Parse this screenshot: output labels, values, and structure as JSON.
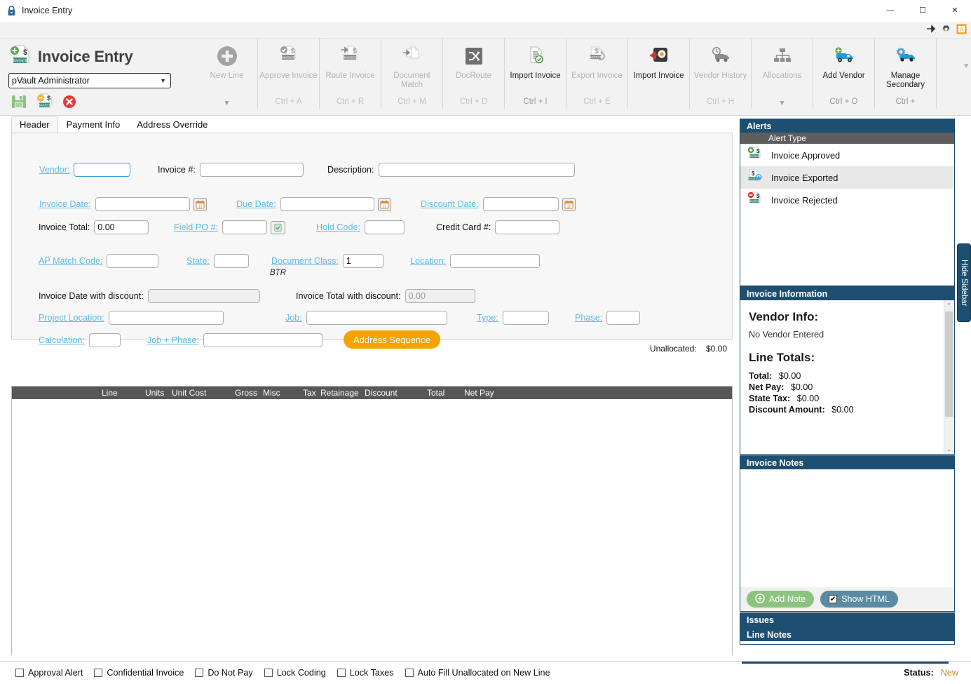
{
  "window": {
    "title": "Invoice Entry",
    "icon": "lock-icon",
    "minimize": "—",
    "maximize": "☐",
    "close": "✕"
  },
  "quickstrip": {
    "pin": "pin-icon",
    "settings": "gear-icon",
    "app": "app-icon"
  },
  "ribbon": {
    "app_title": "Invoice Entry",
    "app_icon": "invoice-add-icon",
    "user": "pVault Administrator",
    "user_caret": "▼",
    "quick_actions": [
      {
        "name": "save-icon",
        "label": "Save"
      },
      {
        "name": "save-invoice-icon",
        "label": "Save Invoice"
      },
      {
        "name": "cancel-icon",
        "label": "Cancel"
      }
    ],
    "groups": [
      {
        "label": "New Line",
        "shortcut": "",
        "icon": "plus-circle-icon",
        "disabled": true,
        "arrow": "▼"
      },
      {
        "label": "Approve Invoice",
        "shortcut": "Ctrl + A",
        "icon": "approve-invoice-icon",
        "disabled": true,
        "arrow": ""
      },
      {
        "label": "Route Invoice",
        "shortcut": "Ctrl + R",
        "icon": "route-invoice-icon",
        "disabled": true,
        "arrow": ""
      },
      {
        "label": "Document Match",
        "shortcut": "Ctrl + M",
        "icon": "document-match-icon",
        "disabled": true,
        "arrow": ""
      },
      {
        "label": "DocRoute",
        "shortcut": "Ctrl + D",
        "icon": "docroute-icon",
        "disabled": true,
        "arrow": ""
      },
      {
        "label": "Import Invoice",
        "shortcut": "Ctrl + I",
        "icon": "import-invoice-icon",
        "disabled": false,
        "arrow": ""
      },
      {
        "label": "Export Invoice",
        "shortcut": "Ctrl + E",
        "icon": "export-invoice-icon",
        "disabled": true,
        "arrow": ""
      },
      {
        "label": "Import Invoice",
        "shortcut": "",
        "icon": "import-invoice-alt-icon",
        "disabled": false,
        "arrow": ""
      },
      {
        "label": "Vendor History",
        "shortcut": "Ctrl + H",
        "icon": "vendor-history-icon",
        "disabled": true,
        "arrow": ""
      },
      {
        "label": "Allocations",
        "shortcut": "",
        "icon": "allocations-icon",
        "disabled": true,
        "arrow": "▼"
      },
      {
        "label": "Add Vendor",
        "shortcut": "Ctrl + O",
        "icon": "add-vendor-icon",
        "disabled": false,
        "arrow": ""
      },
      {
        "label": "Manage Secondary",
        "shortcut": "Ctrl +",
        "icon": "manage-secondary-icon",
        "disabled": false,
        "arrow": ""
      }
    ],
    "scroll_arrow": "▼"
  },
  "tabs": [
    {
      "label": "Header",
      "active": true
    },
    {
      "label": "Payment Info",
      "active": false
    },
    {
      "label": "Address Override",
      "active": false
    }
  ],
  "form": {
    "vendor": {
      "label": "Vendor:",
      "value": "",
      "link": true
    },
    "invoice_number": {
      "label": "Invoice #:",
      "value": "",
      "link": false
    },
    "description": {
      "label": "Description:",
      "value": "",
      "link": false
    },
    "invoice_date": {
      "label": "Invoice Date:",
      "value": "",
      "link": true,
      "calendar": "calendar-icon"
    },
    "due_date": {
      "label": "Due Date:",
      "value": "",
      "link": false,
      "calendar": "calendar-icon"
    },
    "discount_date": {
      "label": "Discount Date:",
      "value": "",
      "link": true,
      "calendar": "calendar-icon"
    },
    "invoice_total": {
      "label": "Invoice Total:",
      "value": "0.00",
      "link": false
    },
    "field_po": {
      "label": "Field PO #:",
      "value": "",
      "link": true,
      "button": "po-lookup-icon"
    },
    "hold_code": {
      "label": "Hold Code:",
      "value": "",
      "link": true
    },
    "credit_card": {
      "label": "Credit Card #:",
      "value": "",
      "link": false
    },
    "ap_match_code": {
      "label": "AP Match Code:",
      "value": "",
      "link": true
    },
    "state": {
      "label": "State:",
      "value": "",
      "link": true
    },
    "document_class": {
      "label": "Document Class:",
      "value": "1",
      "link": true,
      "note": "BTR"
    },
    "location": {
      "label": "Location:",
      "value": "",
      "link": true
    },
    "invoice_date_discount": {
      "label": "Invoice Date with discount:",
      "value": "",
      "link": false
    },
    "invoice_total_discount": {
      "label": "Invoice Total with discount:",
      "value": "0.00",
      "link": false
    },
    "project_location": {
      "label": "Project Location:",
      "value": "",
      "link": true
    },
    "job": {
      "label": "Job:",
      "value": "",
      "link": true
    },
    "type": {
      "label": "Type:",
      "value": "",
      "link": true
    },
    "phase": {
      "label": "Phase:",
      "value": "",
      "link": true
    },
    "calculation": {
      "label": "Calculation:",
      "value": "",
      "link": true
    },
    "job_phase": {
      "label": "Job + Phase:",
      "value": "",
      "link": true
    },
    "address_sequence_button": "Address Sequence"
  },
  "unallocated": {
    "label": "Unallocated:",
    "value": "$0.00"
  },
  "grid": {
    "columns": [
      "Line",
      "Units",
      "Unit Cost",
      "Gross",
      "Misc",
      "Tax",
      "Retainage",
      "Discount",
      "Total",
      "Net Pay"
    ],
    "rows": []
  },
  "sidebar": {
    "hide_label": "Hide Sidebar",
    "alerts": {
      "title": "Alerts",
      "column_header": "Alert Type",
      "items": [
        {
          "label": "Invoice Approved",
          "icon": "invoice-approved-icon",
          "selected": false
        },
        {
          "label": "Invoice Exported",
          "icon": "invoice-exported-icon",
          "selected": true
        },
        {
          "label": "Invoice Rejected",
          "icon": "invoice-rejected-icon",
          "selected": false
        }
      ]
    },
    "invoice_information": {
      "title": "Invoice Information",
      "vendor_heading": "Vendor Info:",
      "vendor_text": "No Vendor Entered",
      "line_totals_heading": "Line Totals:",
      "totals": [
        {
          "label": "Total:",
          "value": "$0.00"
        },
        {
          "label": "Net Pay:",
          "value": "$0.00"
        },
        {
          "label": "State Tax:",
          "value": "$0.00"
        },
        {
          "label": "Discount Amount:",
          "value": "$0.00"
        }
      ],
      "scroll_up": "⌃",
      "scroll_down": "⌄"
    },
    "invoice_notes": {
      "title": "Invoice Notes",
      "content": "",
      "add_note_button": "Add Note",
      "add_note_icon": "plus-circle-icon",
      "show_html_button": "Show HTML",
      "show_html_checked": true,
      "check_glyph": "✔"
    },
    "issues": {
      "title": "Issues"
    },
    "line_notes": {
      "title": "Line Notes"
    }
  },
  "statusbar": {
    "checkboxes": [
      {
        "label": "Approval Alert",
        "checked": false
      },
      {
        "label": "Confidential Invoice",
        "checked": false
      },
      {
        "label": "Do Not Pay",
        "checked": false
      },
      {
        "label": "Lock Coding",
        "checked": false
      },
      {
        "label": "Lock Taxes",
        "checked": false
      },
      {
        "label": "Auto Fill Unallocated on New Line",
        "checked": false
      }
    ],
    "status_label": "Status:",
    "status_value": "New"
  },
  "colors": {
    "panel_header": "#1d4f72",
    "accent_orange": "#f5a300",
    "link_blue": "#5cbbe8",
    "grid_header": "#575757",
    "status_value": "#c98a2a"
  }
}
